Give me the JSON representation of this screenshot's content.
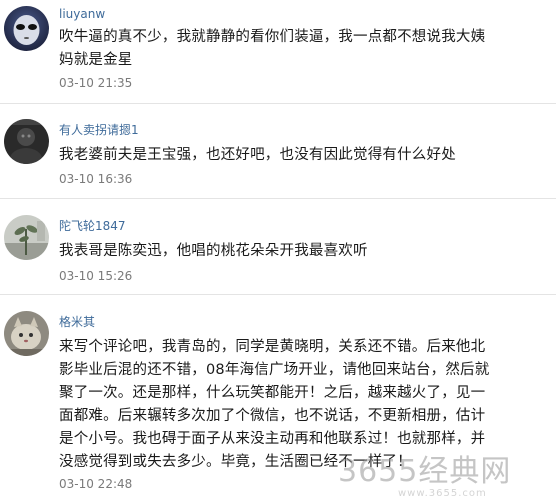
{
  "comments": [
    {
      "username": "liuyanw",
      "content": "吹牛逼的真不少，我就静静的看你们装逼，我一点都不想说我大姨\n妈就是金星",
      "timestamp": "03-10 21:35",
      "avatar": "alien-avatar"
    },
    {
      "username": "有人卖拐请摁1",
      "content": "我老婆前夫是王宝强，也还好吧，也没有因此觉得有什么好处",
      "timestamp": "03-10 16:36",
      "avatar": "dark-portrait-avatar"
    },
    {
      "username": "陀飞轮1847",
      "content": "我表哥是陈奕迅，他唱的桃花朵朵开我最喜欢听",
      "timestamp": "03-10 15:26",
      "avatar": "plant-photo-avatar"
    },
    {
      "username": "格米其",
      "content": "来写个评论吧，我青岛的，同学是黄晓明，关系还不错。后来他北\n影毕业后混的还不错，08年海信广场开业，请他回来站台，然后就\n聚了一次。还是那样，什么玩笑都能开！之后，越来越火了，见一\n面都难。后来辗转多次加了个微信，也不说话，不更新相册，估计\n是个小号。我也碍于面子从来没主动再和他联系过！也就那样，并\n没感觉得到或失去多少。毕竟，生活圈已经不一样了！",
      "timestamp": "03-10 22:48",
      "avatar": "cat-photo-avatar"
    }
  ],
  "watermark": {
    "main": "3655经典网",
    "sub": "www.3655.com"
  },
  "colors": {
    "username": "#3f6b9a",
    "content": "#1a1a1a",
    "timestamp": "#7a7a7a",
    "divider": "#e4e4e4"
  }
}
